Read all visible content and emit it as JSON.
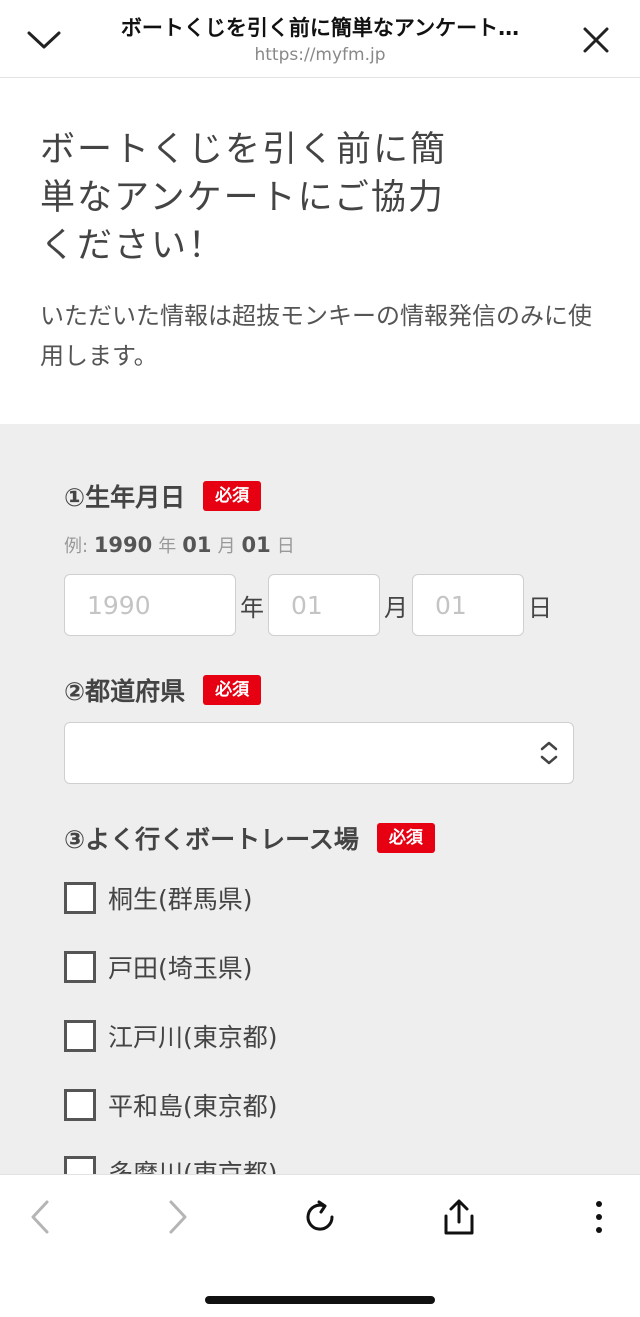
{
  "browser": {
    "page_title": "ボートくじを引く前に簡単なアンケート…",
    "url": "https://myfm.jp"
  },
  "intro": {
    "heading_line1": "ボートくじを引く前に簡",
    "heading_line2": "単なアンケートにご協力",
    "heading_line3": "ください！",
    "description": "いただいた情報は超抜モンキーの情報発信のみに使用します。"
  },
  "form": {
    "required_badge": "必須",
    "birthdate": {
      "label": "①生年月日",
      "example_prefix": "例:",
      "example_year": "1990",
      "example_month": "01",
      "example_day": "01",
      "year_placeholder": "1990",
      "month_placeholder": "01",
      "day_placeholder": "01",
      "unit_year": "年",
      "unit_month": "月",
      "unit_day": "日"
    },
    "prefecture": {
      "label": "②都道府県",
      "selected": ""
    },
    "boat_race": {
      "label": "③よく行くボートレース場",
      "options": [
        "桐生(群馬県)",
        "戸田(埼玉県)",
        "江戸川(東京都)",
        "平和島(東京都)",
        "多摩川(東京都)"
      ]
    }
  }
}
